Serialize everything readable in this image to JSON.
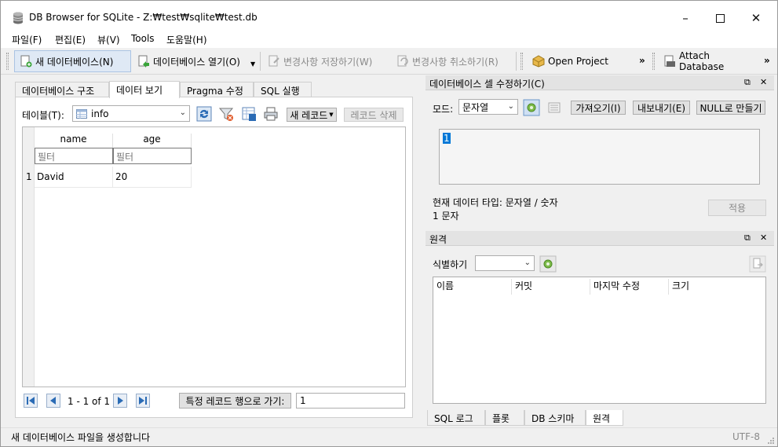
{
  "window": {
    "title": "DB Browser for SQLite - Z:₩test₩sqlite₩test.db",
    "min_glyph": "–",
    "max_glyph": "☐",
    "close_glyph": "✕"
  },
  "menu": [
    "파일(F)",
    "편집(E)",
    "뷰(V)",
    "Tools",
    "도움말(H)"
  ],
  "toolbar": {
    "new_db": "새 데이터베이스(N)",
    "open_db": "데이터베이스 열기(O)",
    "write_changes": "변경사항 저장하기(W)",
    "revert_changes": "변경사항 취소하기(R)",
    "open_project": "Open Project",
    "attach_db": "Attach Database",
    "overflow": "»"
  },
  "left_tabs": [
    "데이터베이스 구조",
    "데이터 보기",
    "Pragma 수정",
    "SQL 실행"
  ],
  "browse": {
    "table_label": "테이블(T):",
    "table_value": "info",
    "new_record": "새 레코드",
    "delete_record": "레코드 삭제",
    "columns": [
      "name",
      "age"
    ],
    "filter_placeholder": "필터",
    "rows": [
      {
        "num": "1",
        "name": "David",
        "age": "20"
      }
    ],
    "record_info": "1 - 1 of 1",
    "goto_label": "특정 레코드 행으로 가기:",
    "goto_value": "1"
  },
  "edit_cell": {
    "title": "데이터베이스 셀 수정하기(C)",
    "mode_label": "모드:",
    "mode_value": "문자열",
    "import": "가져오기(I)",
    "export": "내보내기(E)",
    "set_null": "NULL로 만들기",
    "cell_value": "1",
    "type_info": "현재 데이터 타입: 문자열 / 숫자",
    "size_info": "1 문자",
    "apply": "적용"
  },
  "remote": {
    "title": "원격",
    "identity_label": "식별하기",
    "columns": [
      "이름",
      "커밋",
      "마지막 수정",
      "크기"
    ]
  },
  "bottom_tabs": [
    "SQL 로그",
    "플롯",
    "DB 스키마",
    "원격"
  ],
  "status": {
    "message": "새 데이터베이스 파일을 생성합니다",
    "encoding": "UTF-8"
  },
  "colors": {
    "selection": "#0078d7",
    "toolbar_active": "#dfe9f5",
    "dock_header": "#e3e3e3"
  }
}
